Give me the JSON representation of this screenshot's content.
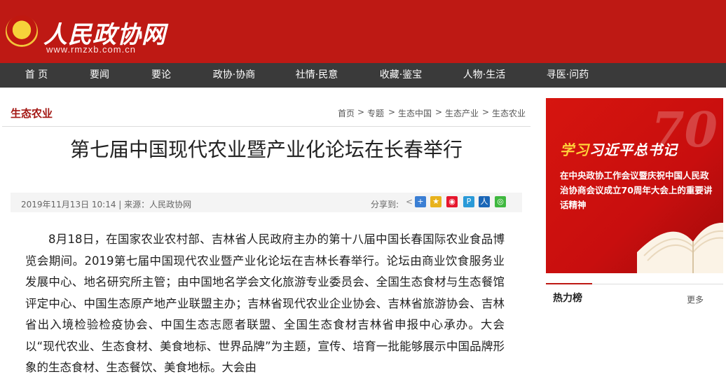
{
  "header": {
    "site_name": "人民政协网",
    "url": "www.rmzxb.com.cn"
  },
  "nav": {
    "items": [
      {
        "label": "首 页"
      },
      {
        "label": "要闻"
      },
      {
        "label": "要论"
      },
      {
        "label": "政协·协商"
      },
      {
        "label": "社情·民意"
      },
      {
        "label": "收藏·鉴宝"
      },
      {
        "label": "人物·生活"
      },
      {
        "label": "寻医·问药"
      }
    ]
  },
  "section": {
    "title": "生态农业"
  },
  "breadcrumb": {
    "items": [
      "首页",
      "专题",
      "生态中国",
      "生态产业",
      "生态农业"
    ],
    "separator": ">"
  },
  "article": {
    "title": "第七届中国现代农业暨产业化论坛在长春举行",
    "meta": "2019年11月13日 10:14 | 来源：人民政协网",
    "share_label": "分享到:",
    "body": "8月18日，在国家农业农村部、吉林省人民政府主办的第十八届中国长春国际农业食品博览会期间。2019第七届中国现代农业暨产业化论坛在吉林长春举行。论坛由商业饮食服务业发展中心、地名研究所主管；由中国地名学会文化旅游专业委员会、全国生态食材与生态餐馆评定中心、中国生态原产地产业联盟主办；吉林省现代农业企业协会、吉林省旅游协会、吉林省出入境检验检疫协会、中国生态志愿者联盟、全国生态食材吉林省申报中心承办。大会以“现代农业、生态食材、美食地标、世界品牌”为主题，宣传、培育一批能够展示中国品牌形象的生态食材、生态餐饮、美食地标。大会由"
  },
  "banner": {
    "headline_study": "学习",
    "headline_rest": "习近平总书记",
    "text": "在中央政协工作会议暨庆祝中国人民政治协商会议成立70周年大会上的重要讲话精神",
    "bg_number": "70"
  },
  "hot": {
    "title": "热力榜",
    "more": "更多"
  },
  "colors": {
    "brand_red": "#be1914",
    "nav_bg": "#3a3a3a"
  }
}
